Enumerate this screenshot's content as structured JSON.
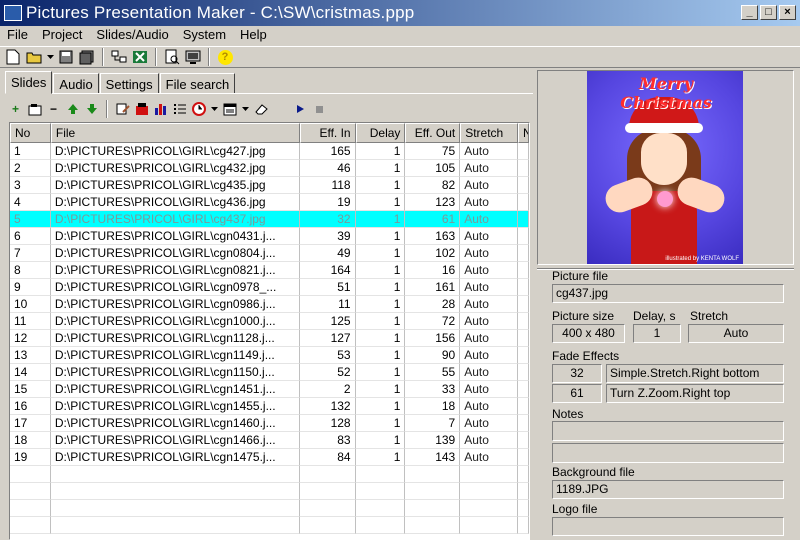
{
  "window": {
    "title": "Pictures Presentation Maker - C:\\SW\\cristmas.ppp",
    "minimize": "_",
    "maximize": "□",
    "close": "×"
  },
  "menu": [
    "File",
    "Project",
    "Slides/Audio",
    "System",
    "Help"
  ],
  "toolbar": {
    "icons": [
      "new-file-icon",
      "open-folder-icon",
      "dropdown-arrow-icon",
      "save-icon",
      "save-all-icon",
      "network-icon",
      "excel-export-icon",
      "print-preview-icon",
      "monitor-preview-icon",
      "help-icon"
    ],
    "help_glyph": "?"
  },
  "tabs": [
    "Slides",
    "Audio",
    "Settings",
    "File search"
  ],
  "active_tab": "Slides",
  "slides_toolbar_icons": [
    "add-icon",
    "add-folder-icon",
    "remove-icon",
    "move-up-icon",
    "move-down-icon",
    "edit-icon",
    "color-icon",
    "chart-icon",
    "list-icon",
    "clock-icon",
    "clock-dropdown-icon",
    "panel-icon",
    "panel-dropdown-icon",
    "eraser-icon",
    "play-icon",
    "stop-icon"
  ],
  "table": {
    "headers": [
      "No",
      "File",
      "Eff. In",
      "Delay",
      "Eff. Out",
      "Stretch",
      "N"
    ],
    "selected_row": 4,
    "rows": [
      [
        "1",
        "D:\\PICTURES\\PRICOL\\GIRL\\cg427.jpg",
        "165",
        "1",
        "75",
        "Auto"
      ],
      [
        "2",
        "D:\\PICTURES\\PRICOL\\GIRL\\cg432.jpg",
        "46",
        "1",
        "105",
        "Auto"
      ],
      [
        "3",
        "D:\\PICTURES\\PRICOL\\GIRL\\cg435.jpg",
        "118",
        "1",
        "82",
        "Auto"
      ],
      [
        "4",
        "D:\\PICTURES\\PRICOL\\GIRL\\cg436.jpg",
        "19",
        "1",
        "123",
        "Auto"
      ],
      [
        "5",
        "D:\\PICTURES\\PRICOL\\GIRL\\cg437.jpg",
        "32",
        "1",
        "61",
        "Auto"
      ],
      [
        "6",
        "D:\\PICTURES\\PRICOL\\GIRL\\cgn0431.j...",
        "39",
        "1",
        "163",
        "Auto"
      ],
      [
        "7",
        "D:\\PICTURES\\PRICOL\\GIRL\\cgn0804.j...",
        "49",
        "1",
        "102",
        "Auto"
      ],
      [
        "8",
        "D:\\PICTURES\\PRICOL\\GIRL\\cgn0821.j...",
        "164",
        "1",
        "16",
        "Auto"
      ],
      [
        "9",
        "D:\\PICTURES\\PRICOL\\GIRL\\cgn0978_...",
        "51",
        "1",
        "161",
        "Auto"
      ],
      [
        "10",
        "D:\\PICTURES\\PRICOL\\GIRL\\cgn0986.j...",
        "11",
        "1",
        "28",
        "Auto"
      ],
      [
        "11",
        "D:\\PICTURES\\PRICOL\\GIRL\\cgn1000.j...",
        "125",
        "1",
        "72",
        "Auto"
      ],
      [
        "12",
        "D:\\PICTURES\\PRICOL\\GIRL\\cgn1128.j...",
        "127",
        "1",
        "156",
        "Auto"
      ],
      [
        "13",
        "D:\\PICTURES\\PRICOL\\GIRL\\cgn1149.j...",
        "53",
        "1",
        "90",
        "Auto"
      ],
      [
        "14",
        "D:\\PICTURES\\PRICOL\\GIRL\\cgn1150.j...",
        "52",
        "1",
        "55",
        "Auto"
      ],
      [
        "15",
        "D:\\PICTURES\\PRICOL\\GIRL\\cgn1451.j...",
        "2",
        "1",
        "33",
        "Auto"
      ],
      [
        "16",
        "D:\\PICTURES\\PRICOL\\GIRL\\cgn1455.j...",
        "132",
        "1",
        "18",
        "Auto"
      ],
      [
        "17",
        "D:\\PICTURES\\PRICOL\\GIRL\\cgn1460.j...",
        "128",
        "1",
        "7",
        "Auto"
      ],
      [
        "18",
        "D:\\PICTURES\\PRICOL\\GIRL\\cgn1466.j...",
        "83",
        "1",
        "139",
        "Auto"
      ],
      [
        "19",
        "D:\\PICTURES\\PRICOL\\GIRL\\cgn1475.j...",
        "84",
        "1",
        "143",
        "Auto"
      ]
    ],
    "selection_color": "#00ffff"
  },
  "preview": {
    "title": "Merry Christmas",
    "credit": "illustrated by KENTA WOLF"
  },
  "properties": {
    "picture_file_label": "Picture file",
    "picture_file": "cg437.jpg",
    "picture_size_label": "Picture size",
    "picture_size": "400 x 480",
    "delay_label": "Delay, s",
    "delay": "1",
    "stretch_label": "Stretch",
    "stretch": "Auto",
    "fade_effects_label": "Fade Effects",
    "fade_in_num": "32",
    "fade_in_name": "Simple.Stretch.Right bottom",
    "fade_out_num": "61",
    "fade_out_name": "Turn Z.Zoom.Right top",
    "notes_label": "Notes",
    "notes": "",
    "background_file_label": "Background file",
    "background_file": "1189.JPG",
    "logo_file_label": "Logo file",
    "logo_file": ""
  }
}
